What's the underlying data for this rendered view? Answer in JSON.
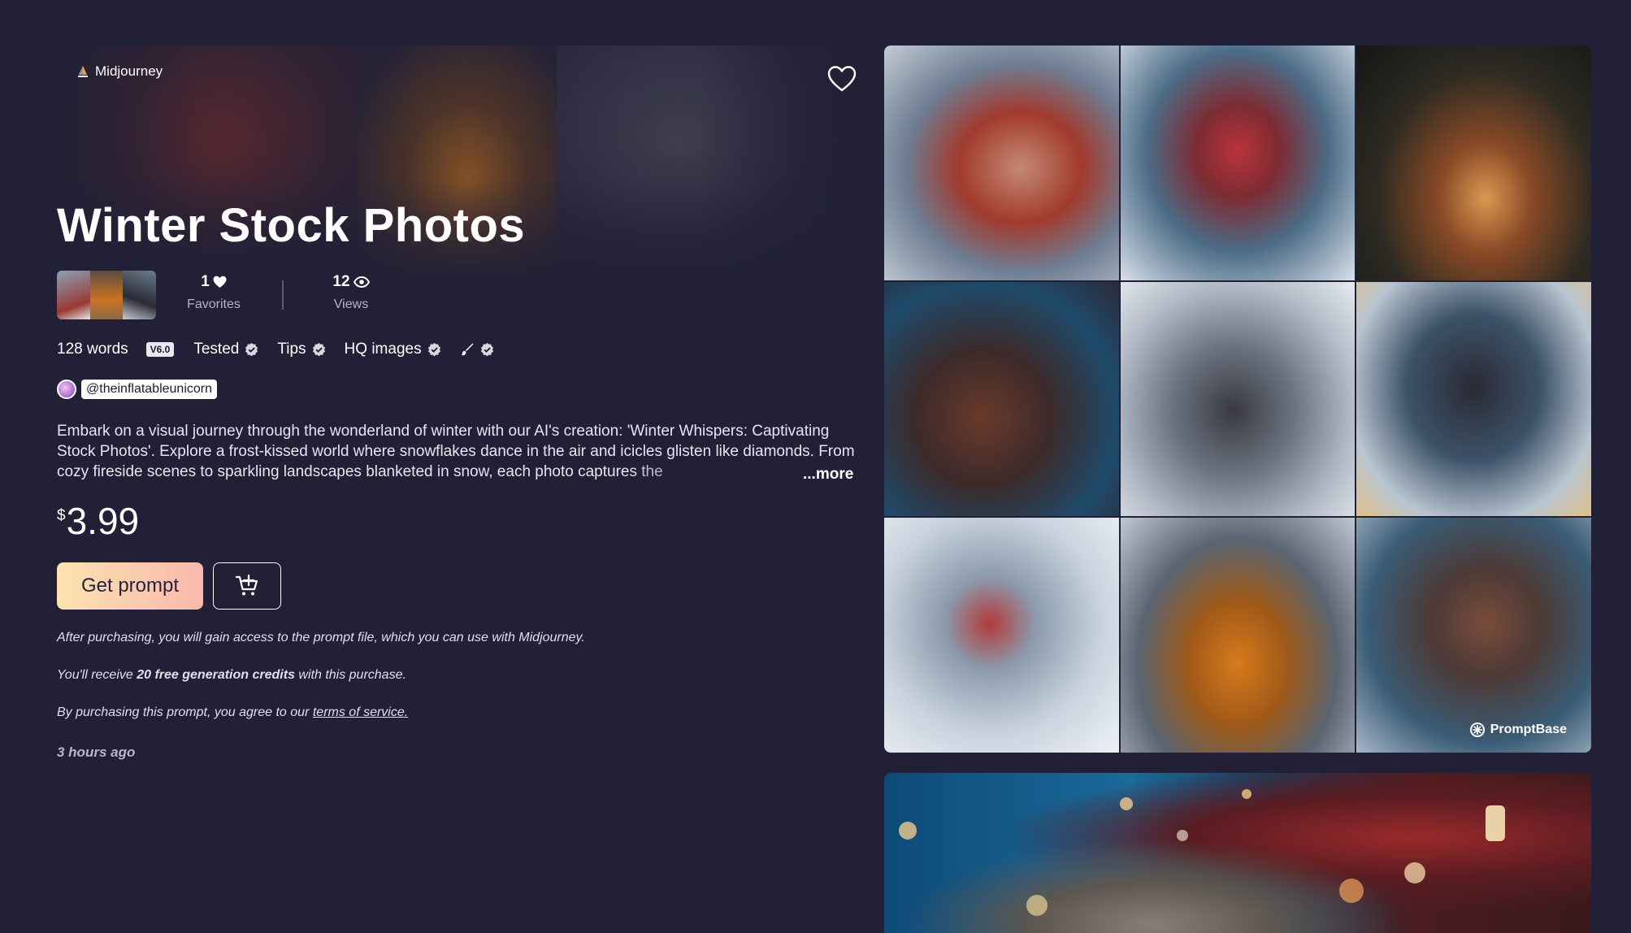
{
  "listing": {
    "model": "Midjourney",
    "title": "Winter Stock Photos",
    "stats": {
      "favorites_count": "1",
      "favorites_label": "Favorites",
      "views_count": "12",
      "views_label": "Views"
    },
    "features": {
      "words": "128 words",
      "version": "V6.0",
      "tested": "Tested",
      "tips": "Tips",
      "hq_images": "HQ images"
    },
    "author": "@theinflatableunicorn",
    "description": "Embark on a visual journey through the wonderland of winter with our AI's creation: 'Winter Whispers: Captivating Stock Photos'. Explore a frost-kissed world where snowflakes dance in the air and icicles glisten like diamonds. From cozy fireside scenes to sparkling landscapes blanketed in snow, each photo captures the",
    "more_label": "...more",
    "price_currency": "$",
    "price_value": "3.99",
    "get_prompt_label": "Get prompt",
    "notes": {
      "access": "After purchasing, you will gain access to the prompt file, which you can use with Midjourney.",
      "credits_prefix": "You'll receive ",
      "credits_bold": "20 free generation credits",
      "credits_suffix": " with this purchase.",
      "terms_prefix": "By purchasing this prompt, you agree to our ",
      "terms_link": "terms of service."
    },
    "timestamp": "3 hours ago"
  },
  "gallery": {
    "watermark": "PromptBase",
    "icons": [
      "heart-outline-icon",
      "heart-icon",
      "eye-icon",
      "verified-check-icon",
      "brush-icon",
      "cart-plus-icon",
      "sail-icon",
      "promptbase-logo-icon"
    ]
  },
  "colors": {
    "background": "#212036",
    "button_gradient_start": "#fbe3b0",
    "button_gradient_end": "#f9b8ae",
    "muted_text": "#b4b4c4"
  }
}
